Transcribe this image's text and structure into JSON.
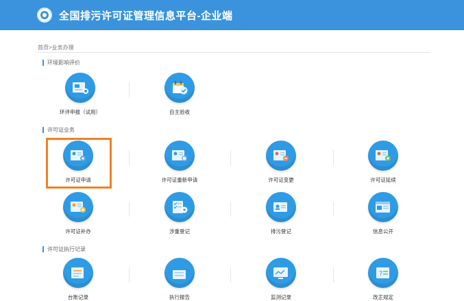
{
  "header": {
    "title": "全国排污许可证管理信息平台-企业端",
    "background": "#3a93dc",
    "logo_icon": "emblem-icon"
  },
  "breadcrumb": "首页>业务办理",
  "sections": [
    {
      "title": "环境影响评价",
      "items": [
        {
          "label": "环评申报（试用）",
          "icon": "document-clip-icon"
        },
        {
          "label": "自主验收",
          "icon": "calendar-check-icon"
        }
      ]
    },
    {
      "title": "许可证业务",
      "items": [
        {
          "label": "许可证申请",
          "icon": "license-icon"
        },
        {
          "label": "许可证重新申请",
          "icon": "license-icon"
        },
        {
          "label": "许可证变更",
          "icon": "license-icon"
        },
        {
          "label": "许可证延续",
          "icon": "license-icon"
        },
        {
          "label": "许可证补办",
          "icon": "license-icon"
        },
        {
          "label": "涉重登记",
          "icon": "checklist-icon"
        },
        {
          "label": "排污登记",
          "icon": "id-card-icon"
        },
        {
          "label": "信息公开",
          "icon": "news-icon"
        }
      ]
    },
    {
      "title": "许可证执行记录",
      "items": [
        {
          "label": "台账记录",
          "icon": "ledger-icon"
        },
        {
          "label": "执行报告",
          "icon": "report-icon"
        },
        {
          "label": "监测记录",
          "icon": "monitor-icon"
        },
        {
          "label": "改正规定",
          "icon": "correction-icon"
        }
      ]
    }
  ],
  "highlight_color": "#f08122"
}
